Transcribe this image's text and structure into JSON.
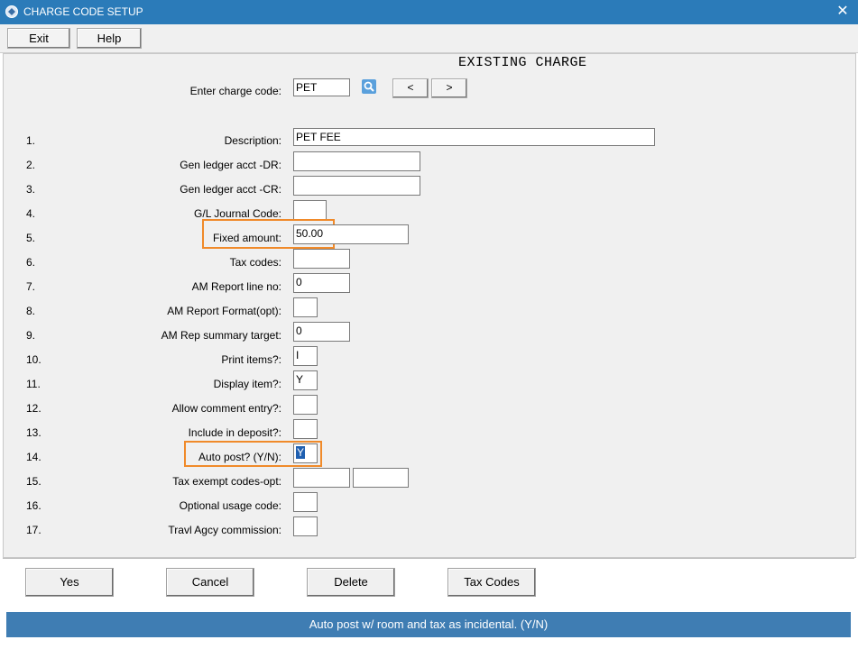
{
  "window": {
    "title": "CHARGE CODE SETUP",
    "close_glyph": "✕"
  },
  "menu": {
    "exit_label": "Exit",
    "help_label": "Help"
  },
  "heading": "EXISTING CHARGE",
  "charge_code": {
    "label": "Enter charge code:",
    "value": "PET",
    "prev": "<",
    "next": ">"
  },
  "fields": [
    {
      "num": "1.",
      "label": "Description:",
      "value": "PET FEE"
    },
    {
      "num": "2.",
      "label": "Gen ledger acct -DR:",
      "value": ""
    },
    {
      "num": "3.",
      "label": "Gen ledger acct -CR:",
      "value": ""
    },
    {
      "num": "4.",
      "label": "G/L Journal Code:",
      "value": ""
    },
    {
      "num": "5.",
      "label": "Fixed amount:",
      "value": "50.00"
    },
    {
      "num": "6.",
      "label": "Tax codes:",
      "value": ""
    },
    {
      "num": "7.",
      "label": "AM Report line no:",
      "value": "0"
    },
    {
      "num": "8.",
      "label": "AM Report Format(opt):",
      "value": ""
    },
    {
      "num": "9.",
      "label": "AM Rep summary target:",
      "value": "0"
    },
    {
      "num": "10.",
      "label": "Print items?:",
      "value": "I"
    },
    {
      "num": "11.",
      "label": "Display item?:",
      "value": "Y"
    },
    {
      "num": "12.",
      "label": "Allow comment entry?:",
      "value": ""
    },
    {
      "num": "13.",
      "label": "Include in deposit?:",
      "value": ""
    },
    {
      "num": "14.",
      "label": "Auto post? (Y/N):",
      "value": "Y"
    },
    {
      "num": "15.",
      "label": "Tax exempt codes-opt:",
      "value": ""
    },
    {
      "num": "16.",
      "label": "Optional usage code:",
      "value": ""
    },
    {
      "num": "17.",
      "label": "Travl Agcy commission:",
      "value": ""
    }
  ],
  "buttons": {
    "yes": "Yes",
    "cancel": "Cancel",
    "delete": "Delete",
    "tax_codes": "Tax Codes"
  },
  "status": "Auto post w/ room and tax as incidental.  (Y/N)",
  "colors": {
    "titlebar": "#2b7bb9",
    "statusbar": "#3f7db3",
    "highlight": "#f08a2a"
  }
}
